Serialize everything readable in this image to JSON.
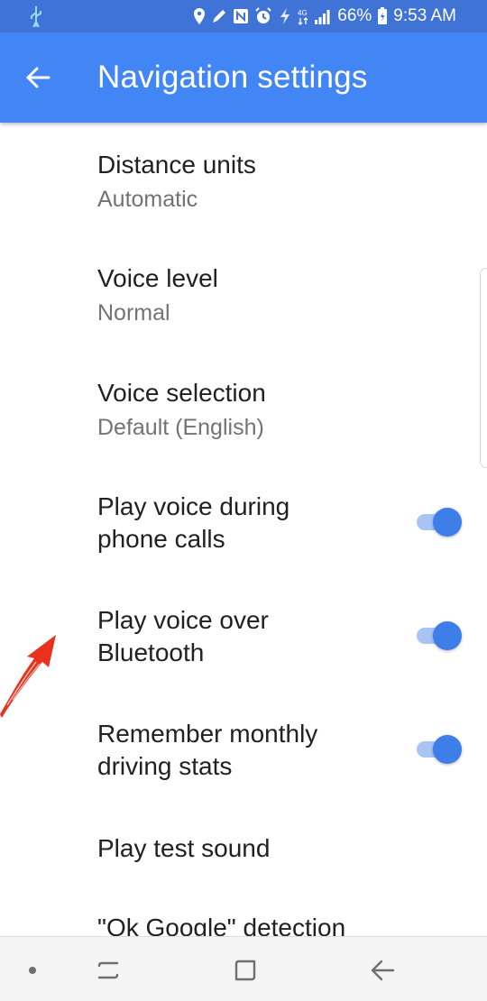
{
  "status_bar": {
    "battery": "66%",
    "time": "9:53 AM",
    "icons": [
      "usb-icon",
      "location-icon",
      "edit-icon",
      "nfc-icon",
      "alarm-icon",
      "data-saver-icon",
      "lte-icon",
      "signal-icon",
      "battery-icon"
    ]
  },
  "app_bar": {
    "title": "Navigation settings",
    "back_icon": "arrow-back-icon"
  },
  "settings": [
    {
      "title": "Distance units",
      "subtitle": "Automatic"
    },
    {
      "title": "Voice level",
      "subtitle": "Normal"
    },
    {
      "title": "Voice selection",
      "subtitle": "Default (English)"
    },
    {
      "title_line1": "Play voice during",
      "title_line2": "phone calls",
      "toggle": true
    },
    {
      "title_line1": "Play voice over",
      "title_line2": "Bluetooth",
      "toggle": true
    },
    {
      "title_line1": "Remember monthly",
      "title_line2": "driving stats",
      "toggle": true
    },
    {
      "title": "Play test sound"
    },
    {
      "title": "\"Ok Google\" detection"
    }
  ],
  "colors": {
    "status_bar": "#3f73d6",
    "app_bar": "#4285f4",
    "toggle_on": "#3d7ee8",
    "annotation": "#e8321e"
  },
  "nav_bar": {
    "icons": [
      "dot-icon",
      "recent-apps-icon",
      "home-icon",
      "back-icon"
    ]
  }
}
